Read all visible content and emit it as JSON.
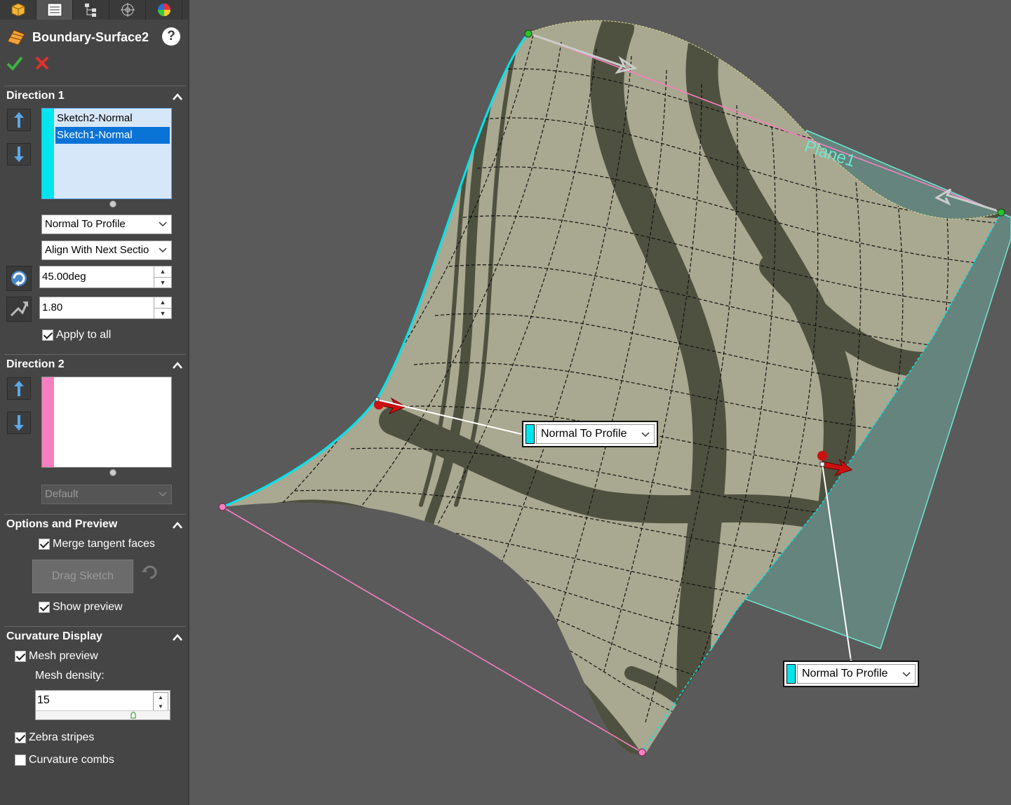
{
  "feature": {
    "title": "Boundary-Surface2",
    "help": "?"
  },
  "direction1": {
    "header": "Direction 1",
    "profiles": [
      "Sketch2-Normal",
      "Sketch1-Normal"
    ],
    "selected_index": 1,
    "tangent_type": "Normal To Profile",
    "alignment": "Align With Next Sectio",
    "draft_angle": "45.00deg",
    "tangent_length": "1.80",
    "apply_to_all_label": "Apply to all",
    "apply_to_all": true,
    "strip_color": "#00e5ee"
  },
  "direction2": {
    "header": "Direction 2",
    "curves": [],
    "tangent_type": "Default",
    "strip_color": "#f77fc0"
  },
  "options": {
    "header": "Options and Preview",
    "merge_tangent_faces_label": "Merge tangent faces",
    "merge_tangent_faces": true,
    "drag_sketch_label": "Drag Sketch",
    "show_preview_label": "Show preview",
    "show_preview": true
  },
  "curvature": {
    "header": "Curvature Display",
    "mesh_preview_label": "Mesh preview",
    "mesh_preview": true,
    "mesh_density_label": "Mesh density:",
    "mesh_density": "15",
    "zebra_label": "Zebra stripes",
    "zebra": true,
    "combs_label": "Curvature combs",
    "combs": false
  },
  "viewport": {
    "plane_label": "Plane1",
    "callout1": "Normal To Profile",
    "callout2": "Normal To Profile",
    "colors": {
      "profile1": "#00e5ee",
      "profile2": "#f77fc0",
      "plane": "#6ee7d2",
      "surface": "#a9a890",
      "stripe": "#4f5140",
      "handle": "#cc1111"
    }
  }
}
